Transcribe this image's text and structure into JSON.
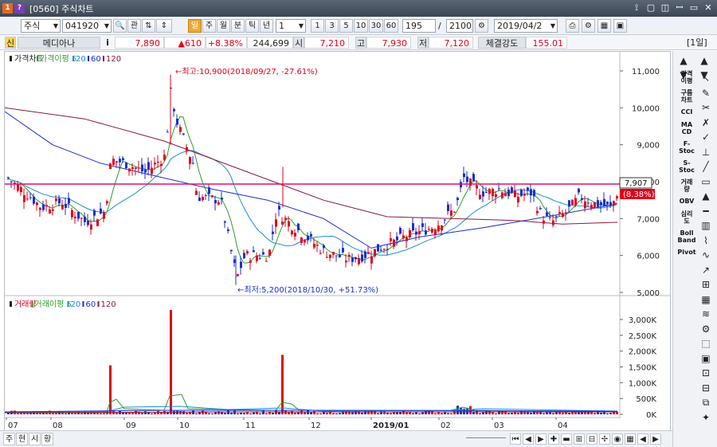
{
  "window": {
    "title": "[0560] 주식차트",
    "icon1": "1",
    "icon2": "?",
    "controls": [
      "ꟷ",
      "▢",
      "◫",
      "▭",
      "✕",
      "⊠"
    ]
  },
  "toolbar": {
    "market": "주식",
    "code": "041920",
    "gwan": "관",
    "periods": [
      "일",
      "주",
      "월",
      "분",
      "틱",
      "년"
    ],
    "unit_value": "1",
    "minute_buttons": [
      "1",
      "3",
      "5",
      "10",
      "30",
      "60"
    ],
    "count": "195",
    "count_total": "2100",
    "date": "2019/04/2",
    "slash": "/"
  },
  "info": {
    "badge": "신",
    "name": "메디아나",
    "i": "i",
    "price": "7,890",
    "change": "▲610",
    "rate": "+8.38%",
    "volume": "244,699",
    "open_label": "시",
    "open": "7,210",
    "high_label": "고",
    "high": "7,930",
    "low_label": "저",
    "low": "7,120",
    "strength_label": "체결강도",
    "strength": "155.01",
    "period_badge": "[1일]"
  },
  "price_panel": {
    "legend": [
      {
        "text": "가격차트",
        "color": "#222222"
      },
      {
        "text": "가격이평 5",
        "color": "#2f9e2f"
      },
      {
        "text": "20",
        "color": "#1a8fd8"
      },
      {
        "text": "60",
        "color": "#1a2fd0"
      },
      {
        "text": "120",
        "color": "#8b1a3a"
      }
    ],
    "max_label": "←최고:10,900(2018/09/27, -27.61%)",
    "min_label": "←최저:5,200(2018/10/30, +51.73%)",
    "current_price_tag": "7,907",
    "current_rate_tag": "(8.38%)",
    "y_ticks": [
      "11,000",
      "10,000",
      "9,000",
      "8,000",
      "7,000",
      "6,000",
      "5,000"
    ]
  },
  "volume_panel": {
    "legend": [
      {
        "text": "거래량",
        "color": "#e0001b"
      },
      {
        "text": "거래이평 5",
        "color": "#2f9e2f"
      },
      {
        "text": "20",
        "color": "#1a8fd8"
      },
      {
        "text": "60",
        "color": "#1a2fd0"
      },
      {
        "text": "120",
        "color": "#8b1a3a"
      }
    ],
    "y_ticks": [
      "3,000K",
      "2,500K",
      "2,000K",
      "1,500K",
      "1,000K",
      "500K",
      "0K"
    ]
  },
  "x_axis": [
    "07",
    "08",
    "09",
    "10",
    "11",
    "12",
    "2019/01",
    "02",
    "03",
    "04"
  ],
  "chart_data": {
    "type": "candlestick",
    "title": "",
    "ylim": [
      5000,
      11000
    ],
    "high_point": {
      "date": "2018/09/27",
      "value": 10900
    },
    "low_point": {
      "date": "2018/10/30",
      "value": 5200
    },
    "last_close": 7890,
    "volume_ylim": [
      0,
      3000000
    ],
    "x_labels": [
      "07",
      "08",
      "09",
      "10",
      "11",
      "12",
      "2019/01",
      "02",
      "03",
      "04"
    ]
  },
  "palette": {
    "items": [
      "가격\n이평",
      "구름\n차트",
      "CCI",
      "MA\nCD",
      "F-\nStoc",
      "S-\nStoc",
      "거래\n량",
      "OBV",
      "심리\n도",
      "Boll\nBand",
      "Pivot"
    ]
  },
  "bottombar": {
    "tabs": [
      "주",
      "현",
      "시",
      "황"
    ]
  },
  "colors": {
    "up": "#e0001b",
    "down": "#1a2fd0",
    "hline": "#e0106a"
  }
}
